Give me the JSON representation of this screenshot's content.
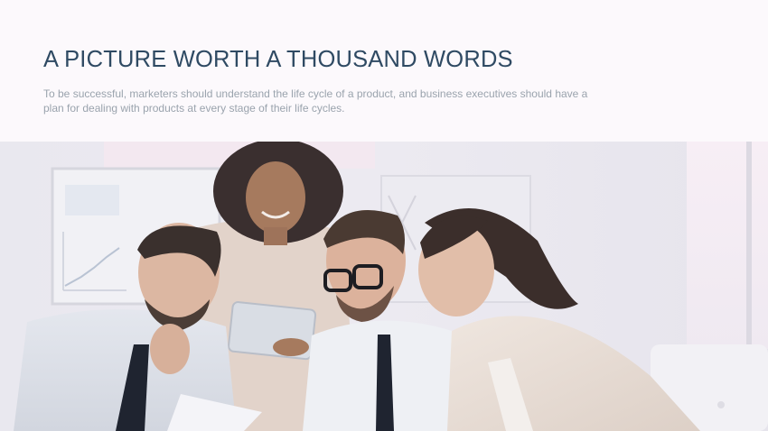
{
  "slide": {
    "title": "A PICTURE WORTH A THOUSAND WORDS",
    "subtitle": "To be successful, marketers should understand the life cycle of a product, and business executives should have a plan for dealing with products at every stage of their life cycles."
  },
  "photo": {
    "subject": "business-team-photo",
    "colors": {
      "wall": "#e7e6ee",
      "window": "#f6eef4",
      "skin": "#e3c2ae",
      "hair_dark": "#3c3130",
      "shirt_light": "#dfe3ea",
      "tie": "#1f2430",
      "blazer": "#e8ddd5"
    }
  }
}
